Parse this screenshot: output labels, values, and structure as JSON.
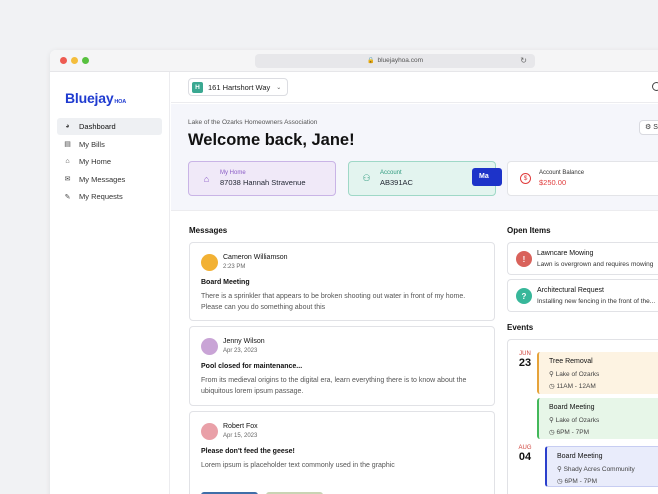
{
  "browser": {
    "url": "bluejayhoa.com"
  },
  "brand": {
    "name": "Bluejay",
    "suffix": "HOA",
    "color": "#1f3bd0"
  },
  "sidebar": {
    "items": [
      {
        "label": "Dashboard",
        "icon": "dashboard-icon",
        "active": true
      },
      {
        "label": "My Bills",
        "icon": "bill-icon"
      },
      {
        "label": "My Home",
        "icon": "home-icon"
      },
      {
        "label": "My Messages",
        "icon": "message-icon"
      },
      {
        "label": "My Requests",
        "icon": "request-icon"
      }
    ]
  },
  "topbar": {
    "house_badge": "H",
    "house": "161 Hartshort Way"
  },
  "hero": {
    "association": "Lake of the Ozarks Homeowners Association",
    "welcome": "Welcome back, Jane!",
    "settings_label": "S",
    "cards": {
      "home": {
        "label": "My Home",
        "value": "87038 Hannah Stravenue"
      },
      "account": {
        "label": "Account",
        "value": "AB391AC"
      },
      "balance": {
        "label": "Account Balance",
        "value": "$250.00",
        "button": "Ma"
      }
    }
  },
  "messages": {
    "title": "Messages",
    "items": [
      {
        "name": "Cameron Williamson",
        "time": "2:23 PM",
        "subject": "Board Meeting",
        "body": "There is a sprinkler that appears to be broken shooting out water in front of my home. Please can you do something about this"
      },
      {
        "name": "Jenny Wilson",
        "time": "Apr 23, 2023",
        "subject": "Pool closed for maintenance...",
        "body": "From its medieval origins to the digital era, learn everything there is to know about the ubiquitous lorem ipsum passage."
      },
      {
        "name": "Robert Fox",
        "time": "Apr 15, 2023",
        "subject": "Please don't feed the geese!",
        "body": "Lorem ipsum is placeholder text commonly used in the graphic"
      }
    ]
  },
  "open_items": {
    "title": "Open Items",
    "items": [
      {
        "title": "Lawncare Mowing",
        "subtitle": "Lawn is overgrown and requires mowing",
        "icon": "warning-icon",
        "color": "#d9625b"
      },
      {
        "title": "Architectural Request",
        "subtitle": "Installing new fencing in the front of the...",
        "icon": "question-icon",
        "color": "#38b79a"
      }
    ]
  },
  "events": {
    "title": "Events",
    "dates": [
      {
        "month": "JUN",
        "day": "23"
      },
      {
        "month": "AUG",
        "day": "04"
      }
    ],
    "items": [
      {
        "title": "Tree Removal",
        "location": "Lake of Ozarks",
        "time": "11AM - 12AM",
        "bg": "#fdf3e2",
        "border": "#e6a33a"
      },
      {
        "title": "Board Meeting",
        "location": "Lake of Ozarks",
        "time": "6PM - 7PM",
        "bg": "#e7f6e8",
        "border": "#43b85a"
      },
      {
        "title": "Board Meeting",
        "location": "Shady Acres Community",
        "time": "6PM - 7PM",
        "bg": "#e9ecfb",
        "border": "#2b3fcc"
      }
    ]
  }
}
